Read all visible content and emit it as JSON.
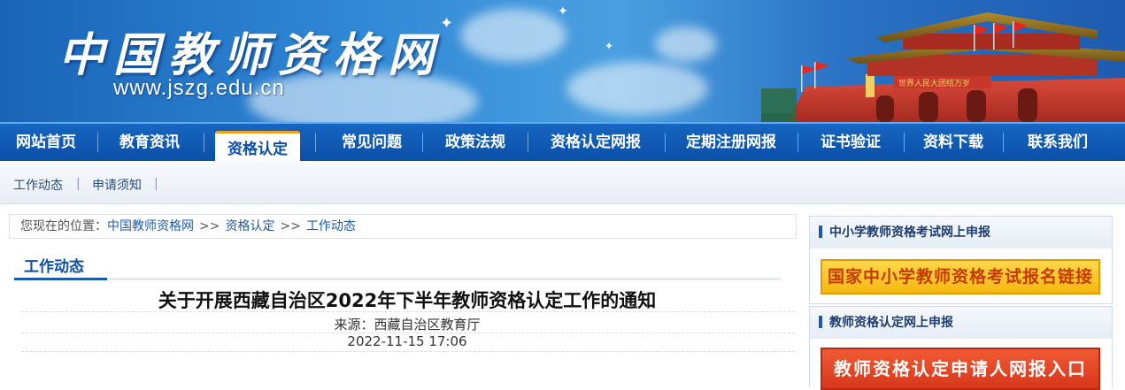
{
  "header": {
    "site_title": "中国教师资格网",
    "site_url": "www.jszg.edu.cn"
  },
  "nav": {
    "items": [
      {
        "label": "网站首页"
      },
      {
        "label": "教育资讯"
      },
      {
        "label": "资格认定"
      },
      {
        "label": "常见问题"
      },
      {
        "label": "政策法规"
      },
      {
        "label": "资格认定网报"
      },
      {
        "label": "定期注册网报"
      },
      {
        "label": "证书验证"
      },
      {
        "label": "资料下载"
      },
      {
        "label": "联系我们"
      }
    ],
    "active": "资格认定"
  },
  "subnav": {
    "items": [
      {
        "label": "工作动态"
      },
      {
        "label": "申请须知"
      }
    ]
  },
  "breadcrumb": {
    "prefix": "您现在的位置：",
    "items": [
      "中国教师资格网",
      "资格认定",
      "工作动态"
    ],
    "separator": ">>"
  },
  "section": {
    "title": "工作动态"
  },
  "article": {
    "title": "关于开展西藏自治区2022年下半年教师资格认定工作的通知",
    "source": "来源：西藏自治区教育厅",
    "date": "2022-11-15 17:06"
  },
  "sidebar": {
    "box1": {
      "heading": "中小学教师资格考试网上申报",
      "button": "国家中小学教师资格考试报名链接"
    },
    "box2": {
      "heading": "教师资格认定网上申报",
      "button": "教师资格认定申请人网报入口"
    }
  },
  "colors": {
    "nav_bg": "#0b4fa6",
    "accent": "#1d5aa8",
    "yellow_button": "#f5b810",
    "red_button": "#d6371c"
  }
}
